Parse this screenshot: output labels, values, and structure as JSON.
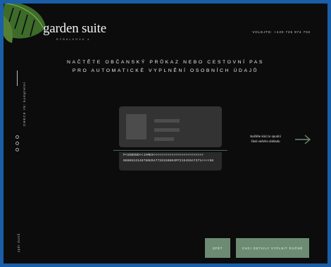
{
  "brand": {
    "name": "garden suite",
    "sub": "RYBALKOVA 4"
  },
  "header": {
    "phone": "VOLEJTE: +420 725 974 702"
  },
  "sidebar": {
    "checkin_label": "CHECK IN: kompletní",
    "back_label": "zpět domů"
  },
  "main": {
    "title_line1": "NAČTĚTE OBČANSKÝ PRŮKAZ NEBO CESTOVNÍ PAS",
    "title_line2": "PRO AUTOMATICKÉ VYPLNĚNÍ OSOBNÍCH ÚDAJŮ",
    "mrz_line1": "P<USBOND<<JAMES<<<<<<<<<<<<<<<<<<<<<<<<<",
    "mrz_line2": "8866524146788USA7726158804M7215455A7371<<<<58",
    "hint_line1": "Načtěte kód ze spodní",
    "hint_line2": "části vašeho dokladu"
  },
  "buttons": {
    "back": "ZPĚT",
    "manual": "CHCI DETAILY VYPLNIT RUČNĚ"
  },
  "colors": {
    "accent": "#6d8b73",
    "background": "#0c0c0c",
    "frame": "#1a5ea8"
  }
}
